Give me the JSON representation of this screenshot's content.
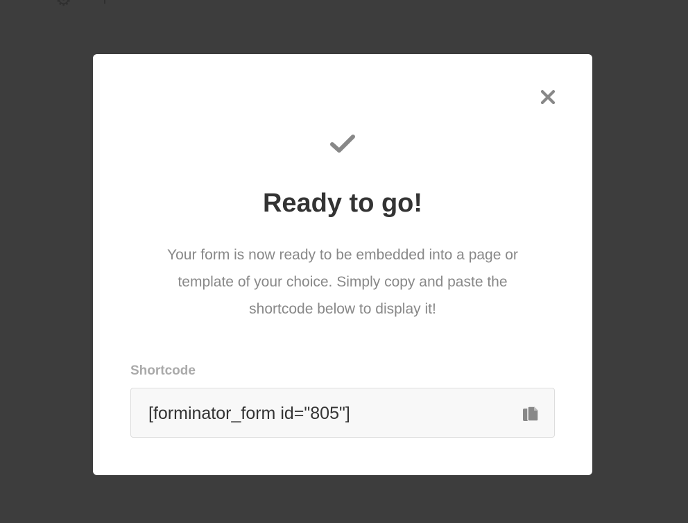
{
  "modal": {
    "title": "Ready to go!",
    "description": "Your form is now ready to be embedded into a page or template of your choice. Simply copy and paste the shortcode below to display it!",
    "shortcode_label": "Shortcode",
    "shortcode_value": "[forminator_form id=\"805\"]"
  },
  "icons": {
    "close": "close-icon",
    "check": "check-icon",
    "copy": "copy-icon"
  },
  "colors": {
    "backdrop": "#3d3d3d",
    "modal_bg": "#ffffff",
    "title": "#333333",
    "muted_text": "#888888",
    "label": "#aaaaaa",
    "icon": "#888888"
  }
}
